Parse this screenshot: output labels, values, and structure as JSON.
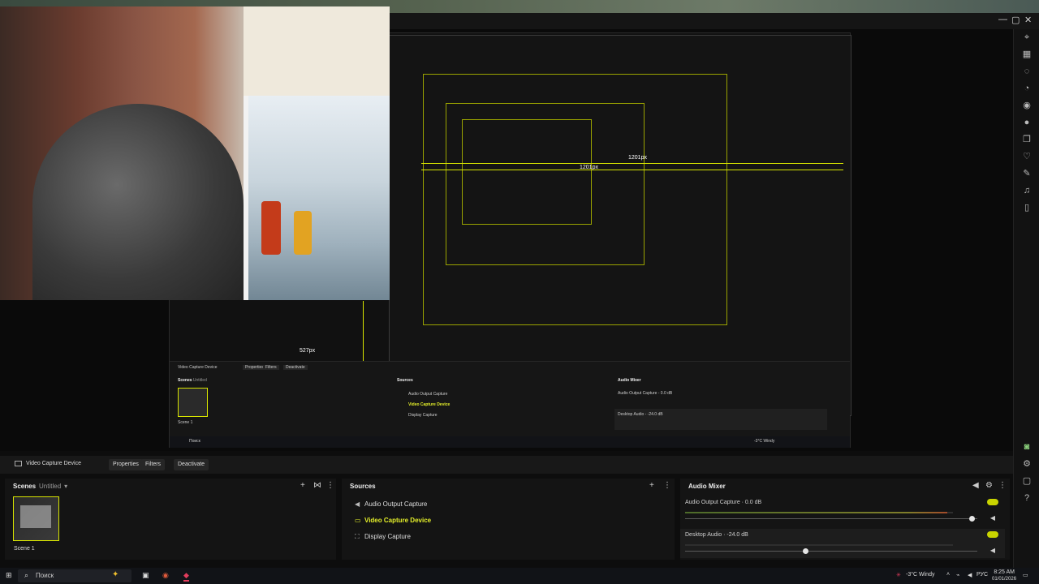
{
  "window": {
    "controls": [
      "—",
      "▢",
      "✕"
    ]
  },
  "preview": {
    "labels": {
      "width_a": "1201px",
      "width_b": "1201px",
      "height_a": "527px"
    }
  },
  "nested": {
    "context_label": "Video Capture Device",
    "properties": "Properties",
    "filters": "Filters",
    "deactivate": "Deactivate",
    "scenes_title": "Scenes",
    "scenes_sub": "Untitled",
    "scene_name": "Scene 1",
    "sources_title": "Sources",
    "sources": [
      "Audio Output Capture",
      "Video Capture Device",
      "Display Capture"
    ],
    "mixer_title": "Audio Mixer",
    "mixer": [
      "Audio Output Capture - 0.0 dB",
      "Desktop Audio - -24.0 dB"
    ],
    "search_label": "Поиск",
    "tray": "-3°C Windy"
  },
  "context_bar": {
    "device_label": "Video Capture Device",
    "properties_label": "Properties",
    "filters_label": "Filters",
    "deactivate_label": "Deactivate"
  },
  "scenes": {
    "title": "Scenes",
    "collection": "Untitled",
    "items": [
      {
        "label": "Scene 1"
      }
    ]
  },
  "sources": {
    "title": "Sources",
    "items": [
      {
        "label": "Audio Output Capture",
        "icon": "speaker-icon"
      },
      {
        "label": "Video Capture Device",
        "icon": "camera-icon",
        "active": true
      },
      {
        "label": "Display Capture",
        "icon": "display-icon"
      }
    ]
  },
  "mixer": {
    "title": "Audio Mixer",
    "channels": [
      {
        "label": "Audio Output Capture · 0.0 dB",
        "level": 0.98,
        "fader": 0.98
      },
      {
        "label": "Desktop Audio · -24.0 dB",
        "level": 0.0,
        "fader": 0.41
      }
    ]
  },
  "taskbar": {
    "search_placeholder": "Поиск",
    "weather": "-3°C  Windy",
    "lang": "РУС",
    "time": "8:25 AM",
    "date": "01/01/2026"
  },
  "colors": {
    "accent": "#d8e500",
    "background": "#141414"
  }
}
